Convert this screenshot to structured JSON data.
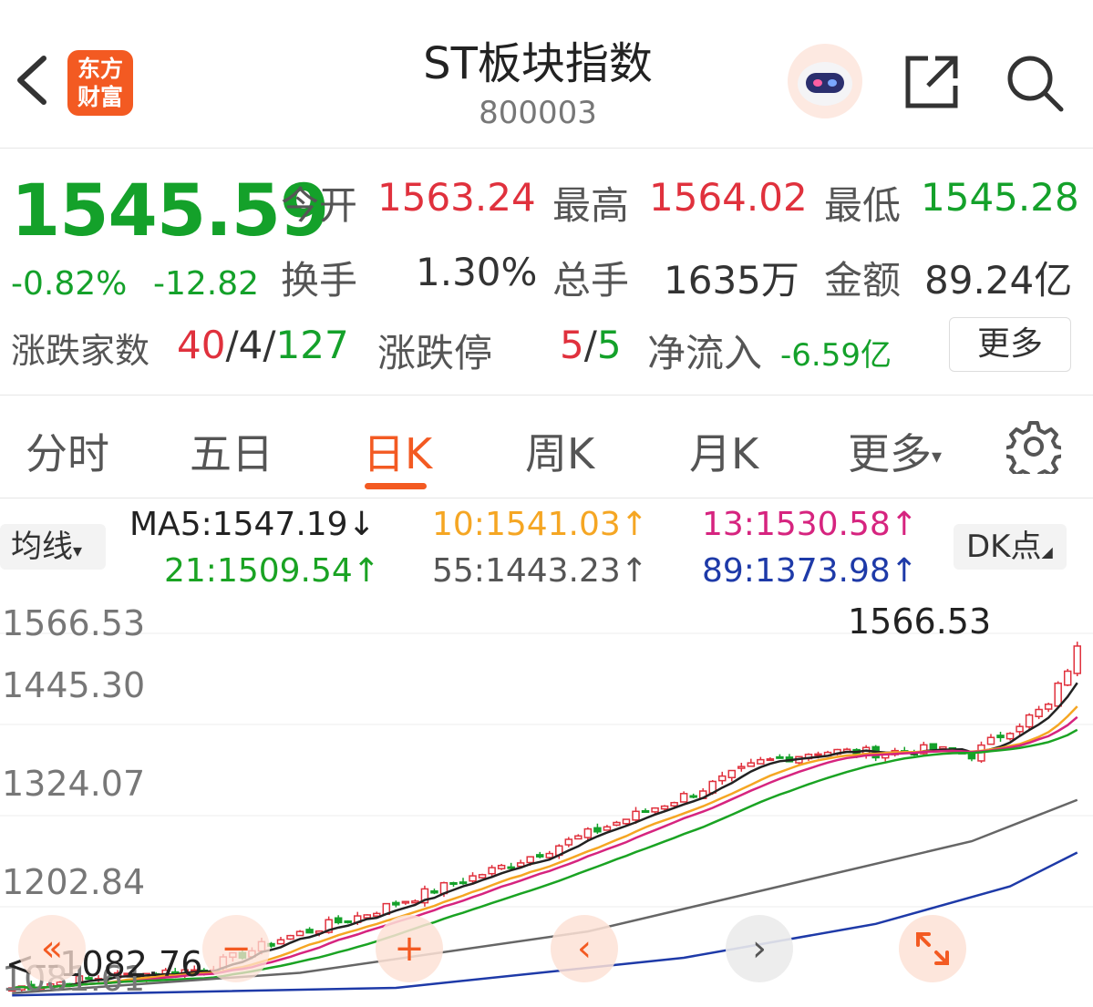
{
  "header": {
    "logo_line1": "东方",
    "logo_line2": "财富",
    "title": "ST板块指数",
    "code": "800003"
  },
  "quote": {
    "price": "1545.59",
    "change_pct": "-0.82%",
    "change": "-12.82",
    "open_label": "今开",
    "open": "1563.24",
    "high_label": "最高",
    "high": "1564.02",
    "low_label": "最低",
    "low": "1545.28",
    "turnover_label": "换手",
    "turnover": "1.30%",
    "volume_label": "总手",
    "volume": "1635万",
    "amount_label": "金额",
    "amount": "89.24亿",
    "advdec_label": "涨跌家数",
    "adv": "40",
    "flat": "4",
    "dec": "127",
    "slash": "/",
    "limit_label": "涨跌停",
    "limit_up": "5",
    "limit_down": "5",
    "inflow_label": "净流入",
    "inflow": "-6.59亿",
    "more_label": "更多"
  },
  "tabs": [
    "分时",
    "五日",
    "日K",
    "周K",
    "月K",
    "更多"
  ],
  "active_tab": "日K",
  "ma_bar": {
    "select_label": "均线",
    "ma5": "MA5:1547.19↓",
    "ma10": "10:1541.03↑",
    "ma13": "13:1530.58↑",
    "ma21": "21:1509.54↑",
    "ma55": "55:1443.23↑",
    "ma89": "89:1373.98↑",
    "dk_label": "DK点"
  },
  "chart_data": {
    "type": "candlestick",
    "y_ticks": [
      "1566.53",
      "1445.30",
      "1324.07",
      "1202.84",
      "1081.61"
    ],
    "max_label": "1566.53",
    "min_label": "1082.76",
    "colors": {
      "ma5": "#222222",
      "ma10": "#f5a623",
      "ma13": "#d6247f",
      "ma21": "#1aa323",
      "ma55": "#666666",
      "ma89": "#1e3aa8",
      "up": "#e0313d",
      "down": "#14a12a"
    }
  }
}
